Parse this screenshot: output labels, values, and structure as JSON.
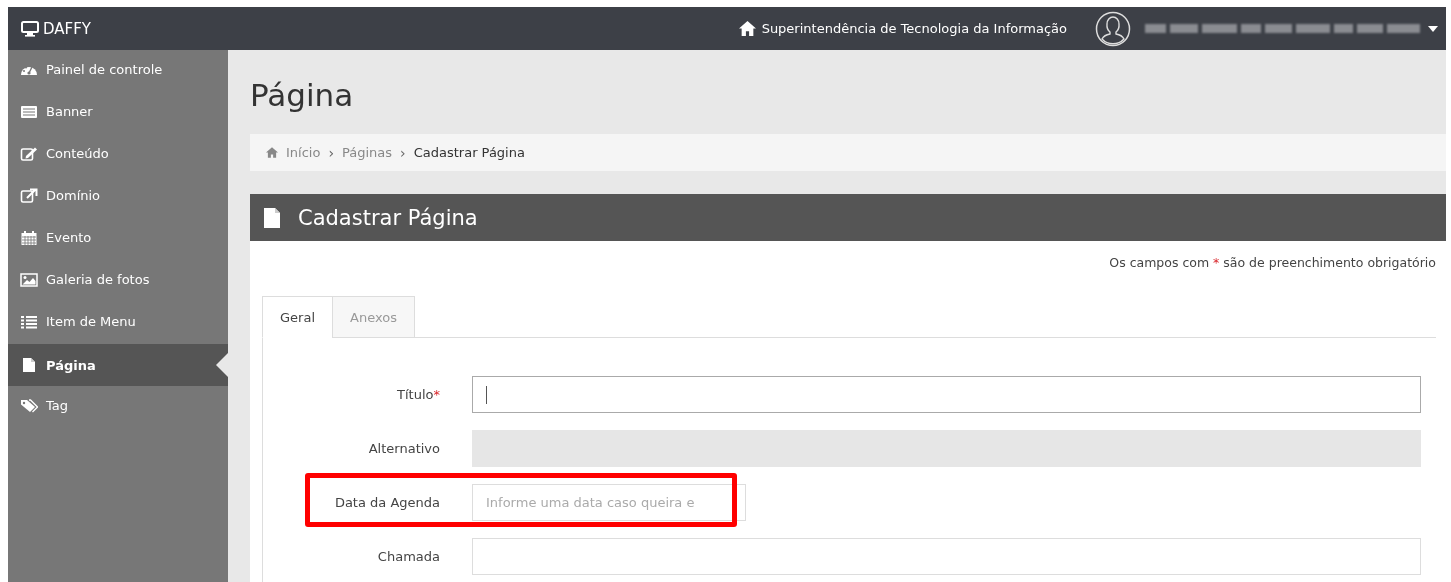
{
  "app": {
    "name": "DAFFY"
  },
  "topbar": {
    "organization": "Superintendência de Tecnologia da Informação"
  },
  "sidebar": {
    "items": [
      {
        "label": "Painel de controle",
        "selected": false
      },
      {
        "label": "Banner",
        "selected": false
      },
      {
        "label": "Conteúdo",
        "selected": false
      },
      {
        "label": "Domínio",
        "selected": false
      },
      {
        "label": "Evento",
        "selected": false
      },
      {
        "label": "Galeria de fotos",
        "selected": false
      },
      {
        "label": "Item de Menu",
        "selected": false
      },
      {
        "label": "Página",
        "selected": true
      },
      {
        "label": "Tag",
        "selected": false
      }
    ]
  },
  "page": {
    "title": "Página"
  },
  "breadcrumb": [
    {
      "label": "Início",
      "current": false
    },
    {
      "separator": "›",
      "label": "Páginas",
      "current": false
    },
    {
      "separator": "›",
      "label": "Cadastrar Página",
      "current": true
    }
  ],
  "panel": {
    "title": "Cadastrar Página",
    "required_note": {
      "before": "Os campos com",
      "mark": "*",
      "after": "são de preenchimento obrigatório"
    },
    "tabs": [
      {
        "label": "Geral",
        "selected": true
      },
      {
        "label": "Anexos",
        "selected": false
      }
    ],
    "fields": [
      {
        "kind": "text",
        "label": "Título",
        "required": true,
        "disabled": false,
        "focused": true,
        "highlighted": false
      },
      {
        "kind": "text",
        "label": "Alternativo",
        "required": false,
        "disabled": true,
        "focused": false,
        "highlighted": false
      },
      {
        "kind": "date",
        "label": "Data da Agenda",
        "required": false,
        "disabled": false,
        "focused": false,
        "highlighted": true,
        "placeholder": "Informe uma data caso queira e"
      },
      {
        "kind": "text",
        "label": "Chamada",
        "required": false,
        "disabled": false,
        "focused": false,
        "highlighted": false
      }
    ]
  }
}
